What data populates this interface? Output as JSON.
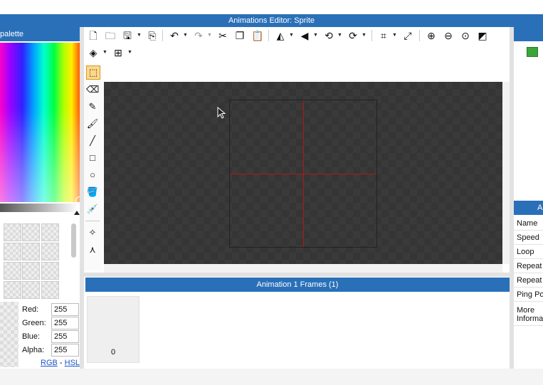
{
  "window": {
    "title": "Animations Editor: Sprite"
  },
  "palette": {
    "header": "palette",
    "red_label": "Red:",
    "red_value": "255",
    "green_label": "Green:",
    "green_value": "255",
    "blue_label": "Blue:",
    "blue_value": "255",
    "alpha_label": "Alpha:",
    "alpha_value": "255",
    "rgb_link": "RGB",
    "link_separator": " - ",
    "hsl_link": "HSL"
  },
  "toolbar": {
    "icons": [
      "new-file",
      "open-folder",
      "save",
      "save-dropdown",
      "export",
      "undo",
      "undo-dropdown",
      "redo",
      "redo-dropdown",
      "cut",
      "copy",
      "paste",
      "flip-horizontal",
      "flip-dropdown",
      "flip-vertical",
      "flip-vertical-dropdown",
      "rotate-left",
      "rotate-left-dropdown",
      "rotate-right",
      "rotate-right-dropdown",
      "crop",
      "crop-dropdown",
      "resize",
      "zoom-in",
      "zoom-out",
      "zoom-reset",
      "toggle-background",
      "layers",
      "layers-dropdown",
      "grid",
      "grid-dropdown"
    ]
  },
  "tools": [
    "selection",
    "eraser",
    "pencil",
    "brush",
    "line",
    "rectangle",
    "ellipse",
    "fill",
    "eyedropper",
    "point",
    "skeleton"
  ],
  "frames": {
    "header": "Animation 1 Frames (1)",
    "items": [
      {
        "index": "0"
      }
    ]
  },
  "properties": {
    "header": "A",
    "rows": [
      "Name",
      "Speed",
      "Loop",
      "Repeat",
      "Repeat",
      "Ping Po",
      "More Informa"
    ]
  },
  "colors": {
    "accent": "#2a70b8",
    "canvas_bg": "#3a3a3a",
    "guide": "#b01818"
  }
}
